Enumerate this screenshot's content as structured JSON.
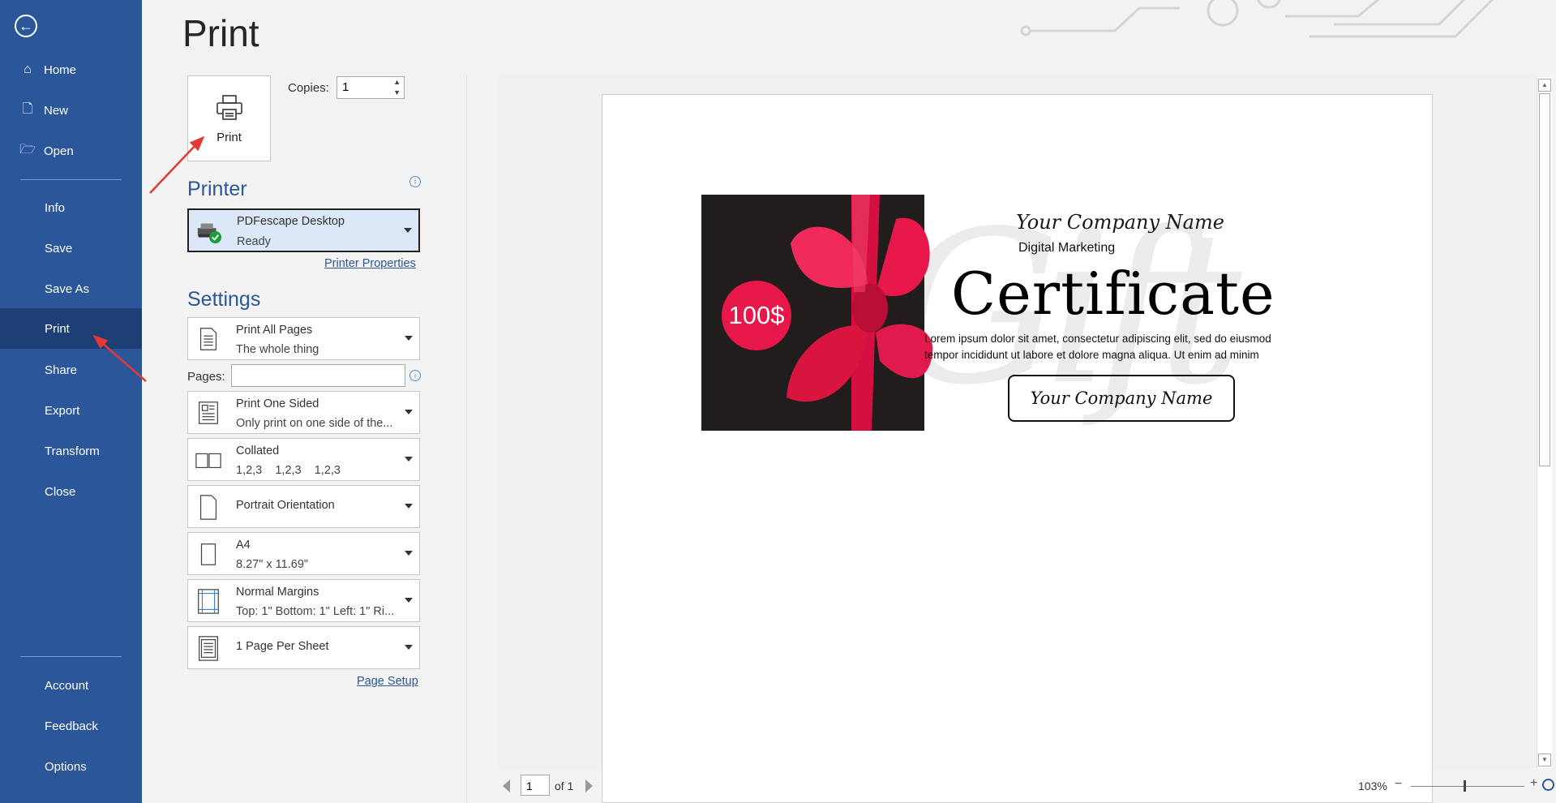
{
  "sidebar": {
    "back_icon": "arrow-left-icon",
    "items": [
      {
        "label": "Home",
        "icon": "home-icon"
      },
      {
        "label": "New",
        "icon": "new-document-icon"
      },
      {
        "label": "Open",
        "icon": "folder-open-icon"
      },
      {
        "label": "Info"
      },
      {
        "label": "Save"
      },
      {
        "label": "Save As"
      },
      {
        "label": "Print",
        "active": true
      },
      {
        "label": "Share"
      },
      {
        "label": "Export"
      },
      {
        "label": "Transform"
      },
      {
        "label": "Close"
      },
      {
        "label": "Account"
      },
      {
        "label": "Feedback"
      },
      {
        "label": "Options"
      }
    ]
  },
  "page_title": "Print",
  "print_button": {
    "label": "Print"
  },
  "copies": {
    "label": "Copies:",
    "value": "1"
  },
  "printer": {
    "heading": "Printer",
    "name": "PDFescape Desktop",
    "status": "Ready",
    "properties_link": "Printer Properties"
  },
  "settings": {
    "heading": "Settings",
    "print_range": {
      "line1": "Print All Pages",
      "line2": "The whole thing"
    },
    "pages_label": "Pages:",
    "sides": {
      "line1": "Print One Sided",
      "line2": "Only print on one side of the..."
    },
    "collation": {
      "line1": "Collated",
      "line2": "1,2,3    1,2,3    1,2,3"
    },
    "orientation": {
      "line1": "Portrait Orientation"
    },
    "paper": {
      "line1": "A4",
      "line2": "8.27\" x 11.69\""
    },
    "margins": {
      "line1": "Normal Margins",
      "line2": "Top: 1\" Bottom: 1\" Left: 1\" Ri..."
    },
    "per_sheet": {
      "line1": "1 Page Per Sheet"
    },
    "page_setup_link": "Page Setup"
  },
  "preview": {
    "certificate": {
      "company_top": "Your Company Name",
      "subtitle": "Digital Marketing",
      "title": "Certificate",
      "lorem_line1": "Lorem ipsum dolor sit amet, consectetur adipiscing elit, sed do eiusmod",
      "lorem_line2": "tempor incididunt ut labore et dolore magna aliqua. Ut enim ad minim",
      "company_box": "Your Company Name",
      "badge": "100$",
      "watermark": "Gift",
      "accent_color": "#e8174a"
    }
  },
  "pager": {
    "current": "1",
    "of_label": "of 1"
  },
  "zoom": {
    "percent": "103%"
  }
}
